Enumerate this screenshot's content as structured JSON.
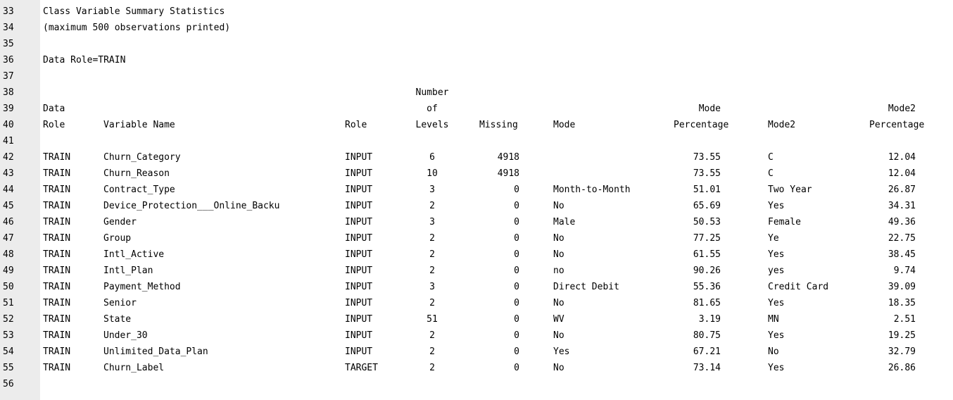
{
  "title": "Class Variable Summary Statistics",
  "subtitle": "(maximum 500 observations printed)",
  "data_role_line": "Data Role=TRAIN",
  "header": {
    "line38": {
      "levels": "Number"
    },
    "line39": {
      "data_role": "Data",
      "levels": "of",
      "mode_pct": "Mode",
      "mode2_pct": "Mode2"
    },
    "line40": {
      "data_role": "Role",
      "variable_name": "Variable Name",
      "role": "Role",
      "levels": "Levels",
      "missing": "Missing",
      "mode": "Mode",
      "mode_pct": "Percentage",
      "mode2": "Mode2",
      "mode2_pct": "Percentage"
    }
  },
  "rows": [
    {
      "line": "42",
      "data_role": "TRAIN",
      "variable": "Churn_Category",
      "role": "INPUT",
      "levels": "6",
      "missing": "4918",
      "mode": "",
      "mode_pct": "73.55",
      "mode2": "C",
      "mode2_pct": "12.04"
    },
    {
      "line": "43",
      "data_role": "TRAIN",
      "variable": "Churn_Reason",
      "role": "INPUT",
      "levels": "10",
      "missing": "4918",
      "mode": "",
      "mode_pct": "73.55",
      "mode2": "C",
      "mode2_pct": "12.04"
    },
    {
      "line": "44",
      "data_role": "TRAIN",
      "variable": "Contract_Type",
      "role": "INPUT",
      "levels": "3",
      "missing": "0",
      "mode": "Month-to-Month",
      "mode_pct": "51.01",
      "mode2": "Two Year",
      "mode2_pct": "26.87"
    },
    {
      "line": "45",
      "data_role": "TRAIN",
      "variable": "Device_Protection___Online_Backu",
      "role": "INPUT",
      "levels": "2",
      "missing": "0",
      "mode": "No",
      "mode_pct": "65.69",
      "mode2": "Yes",
      "mode2_pct": "34.31"
    },
    {
      "line": "46",
      "data_role": "TRAIN",
      "variable": "Gender",
      "role": "INPUT",
      "levels": "3",
      "missing": "0",
      "mode": "Male",
      "mode_pct": "50.53",
      "mode2": "Female",
      "mode2_pct": "49.36"
    },
    {
      "line": "47",
      "data_role": "TRAIN",
      "variable": "Group",
      "role": "INPUT",
      "levels": "2",
      "missing": "0",
      "mode": "No",
      "mode_pct": "77.25",
      "mode2": "Ye",
      "mode2_pct": "22.75"
    },
    {
      "line": "48",
      "data_role": "TRAIN",
      "variable": "Intl_Active",
      "role": "INPUT",
      "levels": "2",
      "missing": "0",
      "mode": "No",
      "mode_pct": "61.55",
      "mode2": "Yes",
      "mode2_pct": "38.45"
    },
    {
      "line": "49",
      "data_role": "TRAIN",
      "variable": "Intl_Plan",
      "role": "INPUT",
      "levels": "2",
      "missing": "0",
      "mode": "no",
      "mode_pct": "90.26",
      "mode2": "yes",
      "mode2_pct": "9.74"
    },
    {
      "line": "50",
      "data_role": "TRAIN",
      "variable": "Payment_Method",
      "role": "INPUT",
      "levels": "3",
      "missing": "0",
      "mode": "Direct Debit",
      "mode_pct": "55.36",
      "mode2": "Credit Card",
      "mode2_pct": "39.09"
    },
    {
      "line": "51",
      "data_role": "TRAIN",
      "variable": "Senior",
      "role": "INPUT",
      "levels": "2",
      "missing": "0",
      "mode": "No",
      "mode_pct": "81.65",
      "mode2": "Yes",
      "mode2_pct": "18.35"
    },
    {
      "line": "52",
      "data_role": "TRAIN",
      "variable": "State",
      "role": "INPUT",
      "levels": "51",
      "missing": "0",
      "mode": "WV",
      "mode_pct": "3.19",
      "mode2": "MN",
      "mode2_pct": "2.51"
    },
    {
      "line": "53",
      "data_role": "TRAIN",
      "variable": "Under_30",
      "role": "INPUT",
      "levels": "2",
      "missing": "0",
      "mode": "No",
      "mode_pct": "80.75",
      "mode2": "Yes",
      "mode2_pct": "19.25"
    },
    {
      "line": "54",
      "data_role": "TRAIN",
      "variable": "Unlimited_Data_Plan",
      "role": "INPUT",
      "levels": "2",
      "missing": "0",
      "mode": "Yes",
      "mode_pct": "67.21",
      "mode2": "No",
      "mode2_pct": "32.79"
    },
    {
      "line": "55",
      "data_role": "TRAIN",
      "variable": "Churn_Label",
      "role": "TARGET",
      "levels": "2",
      "missing": "0",
      "mode": "No",
      "mode_pct": "73.14",
      "mode2": "Yes",
      "mode2_pct": "26.86"
    }
  ],
  "line_numbers": {
    "title": "33",
    "subtitle": "34",
    "blank1": "35",
    "data_role": "36",
    "blank2": "37",
    "h38": "38",
    "h39": "39",
    "h40": "40",
    "blank3": "41",
    "blank4": "56"
  }
}
